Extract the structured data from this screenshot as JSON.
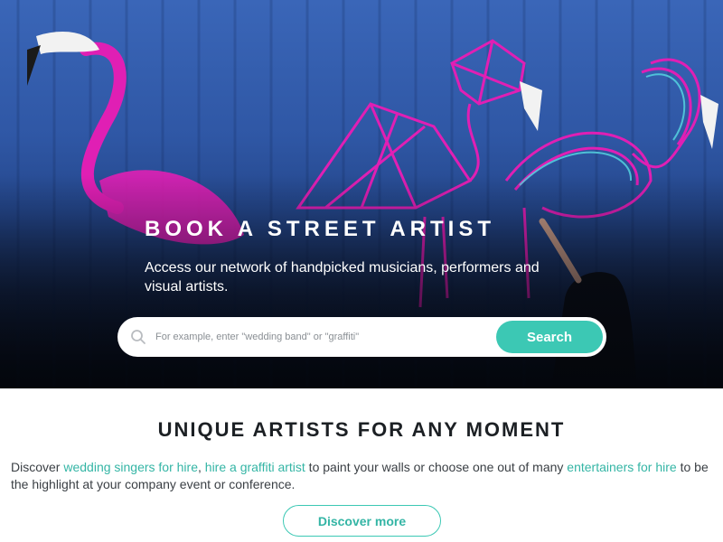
{
  "hero": {
    "title": "BOOK A STREET ARTIST",
    "subtitle": "Access our network of handpicked musicians, performers and visual artists.",
    "image_description": "flamingo-mural-icon"
  },
  "search": {
    "placeholder": "For example, enter \"wedding band\" or \"graffiti\"",
    "value": "",
    "button_label": "Search",
    "icon": "search-icon"
  },
  "section": {
    "title": "UNIQUE ARTISTS FOR ANY MOMENT",
    "text_part1": "Discover ",
    "link1": "wedding singers for hire",
    "text_part2": ", ",
    "link2": "hire a graffiti artist",
    "text_part3": " to paint your walls or choose one out of many ",
    "link3": "entertainers for hire",
    "text_part4": " to be the highlight at your company event or conference.",
    "button_label": "Discover more"
  },
  "colors": {
    "accent": "#3cc8b4",
    "link": "#34b5a5",
    "flamingo": "#e01fb4",
    "sky": "#3a66b8"
  }
}
